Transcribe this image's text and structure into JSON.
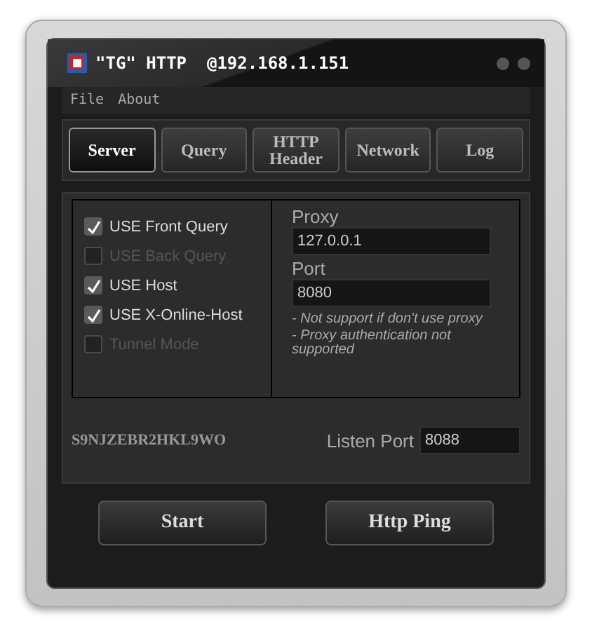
{
  "window": {
    "title": "\"TG\" HTTP  @192.168.1.151"
  },
  "menu": [
    "File",
    "About"
  ],
  "tabs": [
    {
      "label": "Server",
      "selected": true
    },
    {
      "label": "Query",
      "selected": false
    },
    {
      "label": "HTTP Header",
      "selected": false
    },
    {
      "label": "Network",
      "selected": false
    },
    {
      "label": "Log",
      "selected": false
    }
  ],
  "options": [
    {
      "label": "USE Front Query",
      "checked": true,
      "disabled": false
    },
    {
      "label": "USE Back Query",
      "checked": false,
      "disabled": true
    },
    {
      "label": "USE Host",
      "checked": true,
      "disabled": false
    },
    {
      "label": "USE X-Online-Host",
      "checked": true,
      "disabled": false
    },
    {
      "label": "Tunnel Mode",
      "checked": false,
      "disabled": true
    }
  ],
  "proxy": {
    "label": "Proxy",
    "value": "127.0.0.1"
  },
  "port": {
    "label": "Port",
    "value": "8080"
  },
  "notes": [
    "- Not support if don't  use proxy",
    "- Proxy authentication not supported"
  ],
  "code": "S9NJZEBR2HKL9WO",
  "listen_port": {
    "label": "Listen Port",
    "value": "8088"
  },
  "buttons": [
    "Start",
    "Http Ping"
  ]
}
